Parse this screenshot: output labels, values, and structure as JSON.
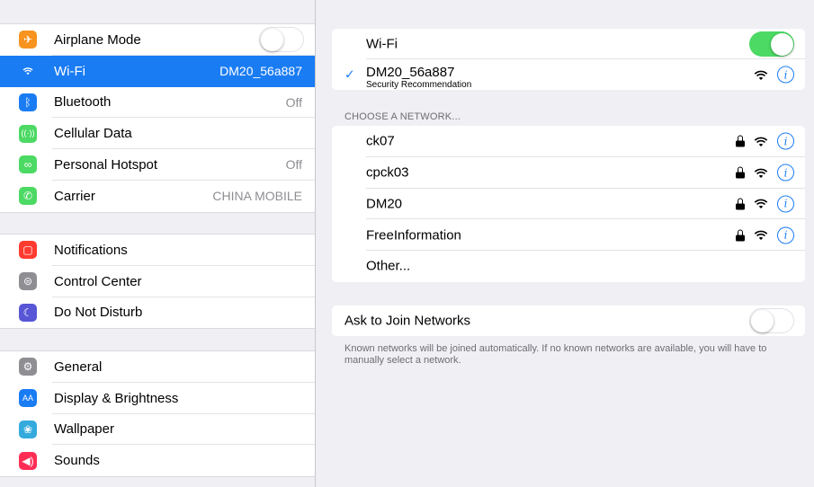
{
  "sidebar": {
    "groups": [
      [
        {
          "label": "Airplane Mode",
          "value": "",
          "toggle": "off",
          "icon_color": "#f7931e",
          "icon": "airplane-icon",
          "glyph": "✈"
        },
        {
          "label": "Wi-Fi",
          "value": "DM20_56a887",
          "icon_color": "#1a7cf3",
          "icon": "wifi-icon",
          "glyph": "",
          "selected": true
        },
        {
          "label": "Bluetooth",
          "value": "Off",
          "icon_color": "#1a7cf3",
          "icon": "bluetooth-icon",
          "glyph": "ᛒ"
        },
        {
          "label": "Cellular Data",
          "value": "",
          "icon_color": "#4cd964",
          "icon": "cellular-icon",
          "glyph": "((·))"
        },
        {
          "label": "Personal Hotspot",
          "value": "Off",
          "icon_color": "#4cd964",
          "icon": "hotspot-icon",
          "glyph": "∞"
        },
        {
          "label": "Carrier",
          "value": "CHINA MOBILE",
          "icon_color": "#4cd964",
          "icon": "phone-icon",
          "glyph": "✆"
        }
      ],
      [
        {
          "label": "Notifications",
          "value": "",
          "icon_color": "#ff3b30",
          "icon": "notifications-icon",
          "glyph": "▢"
        },
        {
          "label": "Control Center",
          "value": "",
          "icon_color": "#8e8e93",
          "icon": "control-center-icon",
          "glyph": "⊜"
        },
        {
          "label": "Do Not Disturb",
          "value": "",
          "icon_color": "#5856d6",
          "icon": "moon-icon",
          "glyph": "☾"
        }
      ],
      [
        {
          "label": "General",
          "value": "",
          "icon_color": "#8e8e93",
          "icon": "gear-icon",
          "glyph": "⚙"
        },
        {
          "label": "Display & Brightness",
          "value": "",
          "icon_color": "#1a7cf3",
          "icon": "display-icon",
          "glyph": "AA"
        },
        {
          "label": "Wallpaper",
          "value": "",
          "icon_color": "#34aadc",
          "icon": "wallpaper-icon",
          "glyph": "❀"
        },
        {
          "label": "Sounds",
          "value": "",
          "icon_color": "#ff2d55",
          "icon": "sounds-icon",
          "glyph": "◀)"
        }
      ]
    ]
  },
  "detail": {
    "wifi_label": "Wi-Fi",
    "wifi_toggle": "on",
    "current_network": {
      "name": "DM20_56a887",
      "subtitle": "Security Recommendation",
      "check": "✓"
    },
    "choose_header": "CHOOSE A NETWORK...",
    "networks": [
      {
        "name": "ck07",
        "locked": true
      },
      {
        "name": "cpck03",
        "locked": true
      },
      {
        "name": "DM20",
        "locked": true
      },
      {
        "name": "FreeInformation",
        "locked": true
      },
      {
        "name": "Other...",
        "locked": false
      }
    ],
    "ask_to_join": {
      "label": "Ask to Join Networks",
      "toggle": "off"
    },
    "footer": "Known networks will be joined automatically. If no known networks are available, you will have to manually select a network.",
    "info_glyph": "i"
  },
  "colors": {
    "accent": "#1a7cf3",
    "toggle_on": "#4cd964"
  }
}
